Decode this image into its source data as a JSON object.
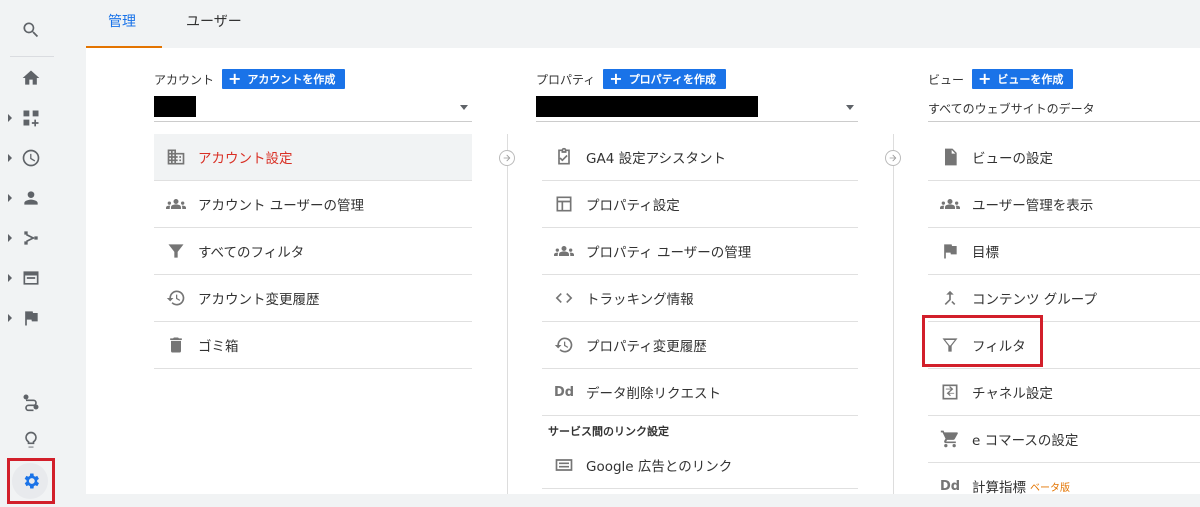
{
  "tabs": {
    "admin": "管理",
    "users": "ユーザー"
  },
  "account": {
    "header_label": "アカウント",
    "create_button": "アカウントを作成",
    "items": [
      {
        "label": "アカウント設定",
        "icon": "building-icon"
      },
      {
        "label": "アカウント ユーザーの管理",
        "icon": "people-icon"
      },
      {
        "label": "すべてのフィルタ",
        "icon": "filter-icon"
      },
      {
        "label": "アカウント変更履歴",
        "icon": "history-icon"
      },
      {
        "label": "ゴミ箱",
        "icon": "trash-icon"
      }
    ]
  },
  "property": {
    "header_label": "プロパティ",
    "create_button": "プロパティを作成",
    "items": [
      {
        "label": "GA4 設定アシスタント",
        "icon": "checklist-icon"
      },
      {
        "label": "プロパティ設定",
        "icon": "layout-icon"
      },
      {
        "label": "プロパティ ユーザーの管理",
        "icon": "people-icon"
      },
      {
        "label": "トラッキング情報",
        "icon": "code-icon"
      },
      {
        "label": "プロパティ変更履歴",
        "icon": "history-icon"
      },
      {
        "label": "データ削除リクエスト",
        "icon": "dd-icon"
      }
    ],
    "section_heading": "サービス間のリンク設定",
    "link_items": [
      {
        "label": "Google 広告とのリンク",
        "icon": "ads-icon"
      }
    ]
  },
  "view": {
    "header_label": "ビュー",
    "create_button": "ビューを作成",
    "selected_view": "すべてのウェブサイトのデータ",
    "items": [
      {
        "label": "ビューの設定",
        "icon": "document-icon"
      },
      {
        "label": "ユーザー管理を表示",
        "icon": "people-icon"
      },
      {
        "label": "目標",
        "icon": "flag-icon"
      },
      {
        "label": "コンテンツ グループ",
        "icon": "merge-icon"
      },
      {
        "label": "フィルタ",
        "icon": "filter-icon"
      },
      {
        "label": "チャネル設定",
        "icon": "channel-icon"
      },
      {
        "label": "e コマースの設定",
        "icon": "cart-icon"
      },
      {
        "label": "計算指標",
        "icon": "dd-icon",
        "badge": "ベータ版"
      }
    ]
  },
  "dd_glyph": "Dd",
  "colors": {
    "accent": "#1a73e8",
    "selected_text": "#d93025",
    "highlight": "#d21f2a",
    "tab_underline": "#e37400"
  }
}
